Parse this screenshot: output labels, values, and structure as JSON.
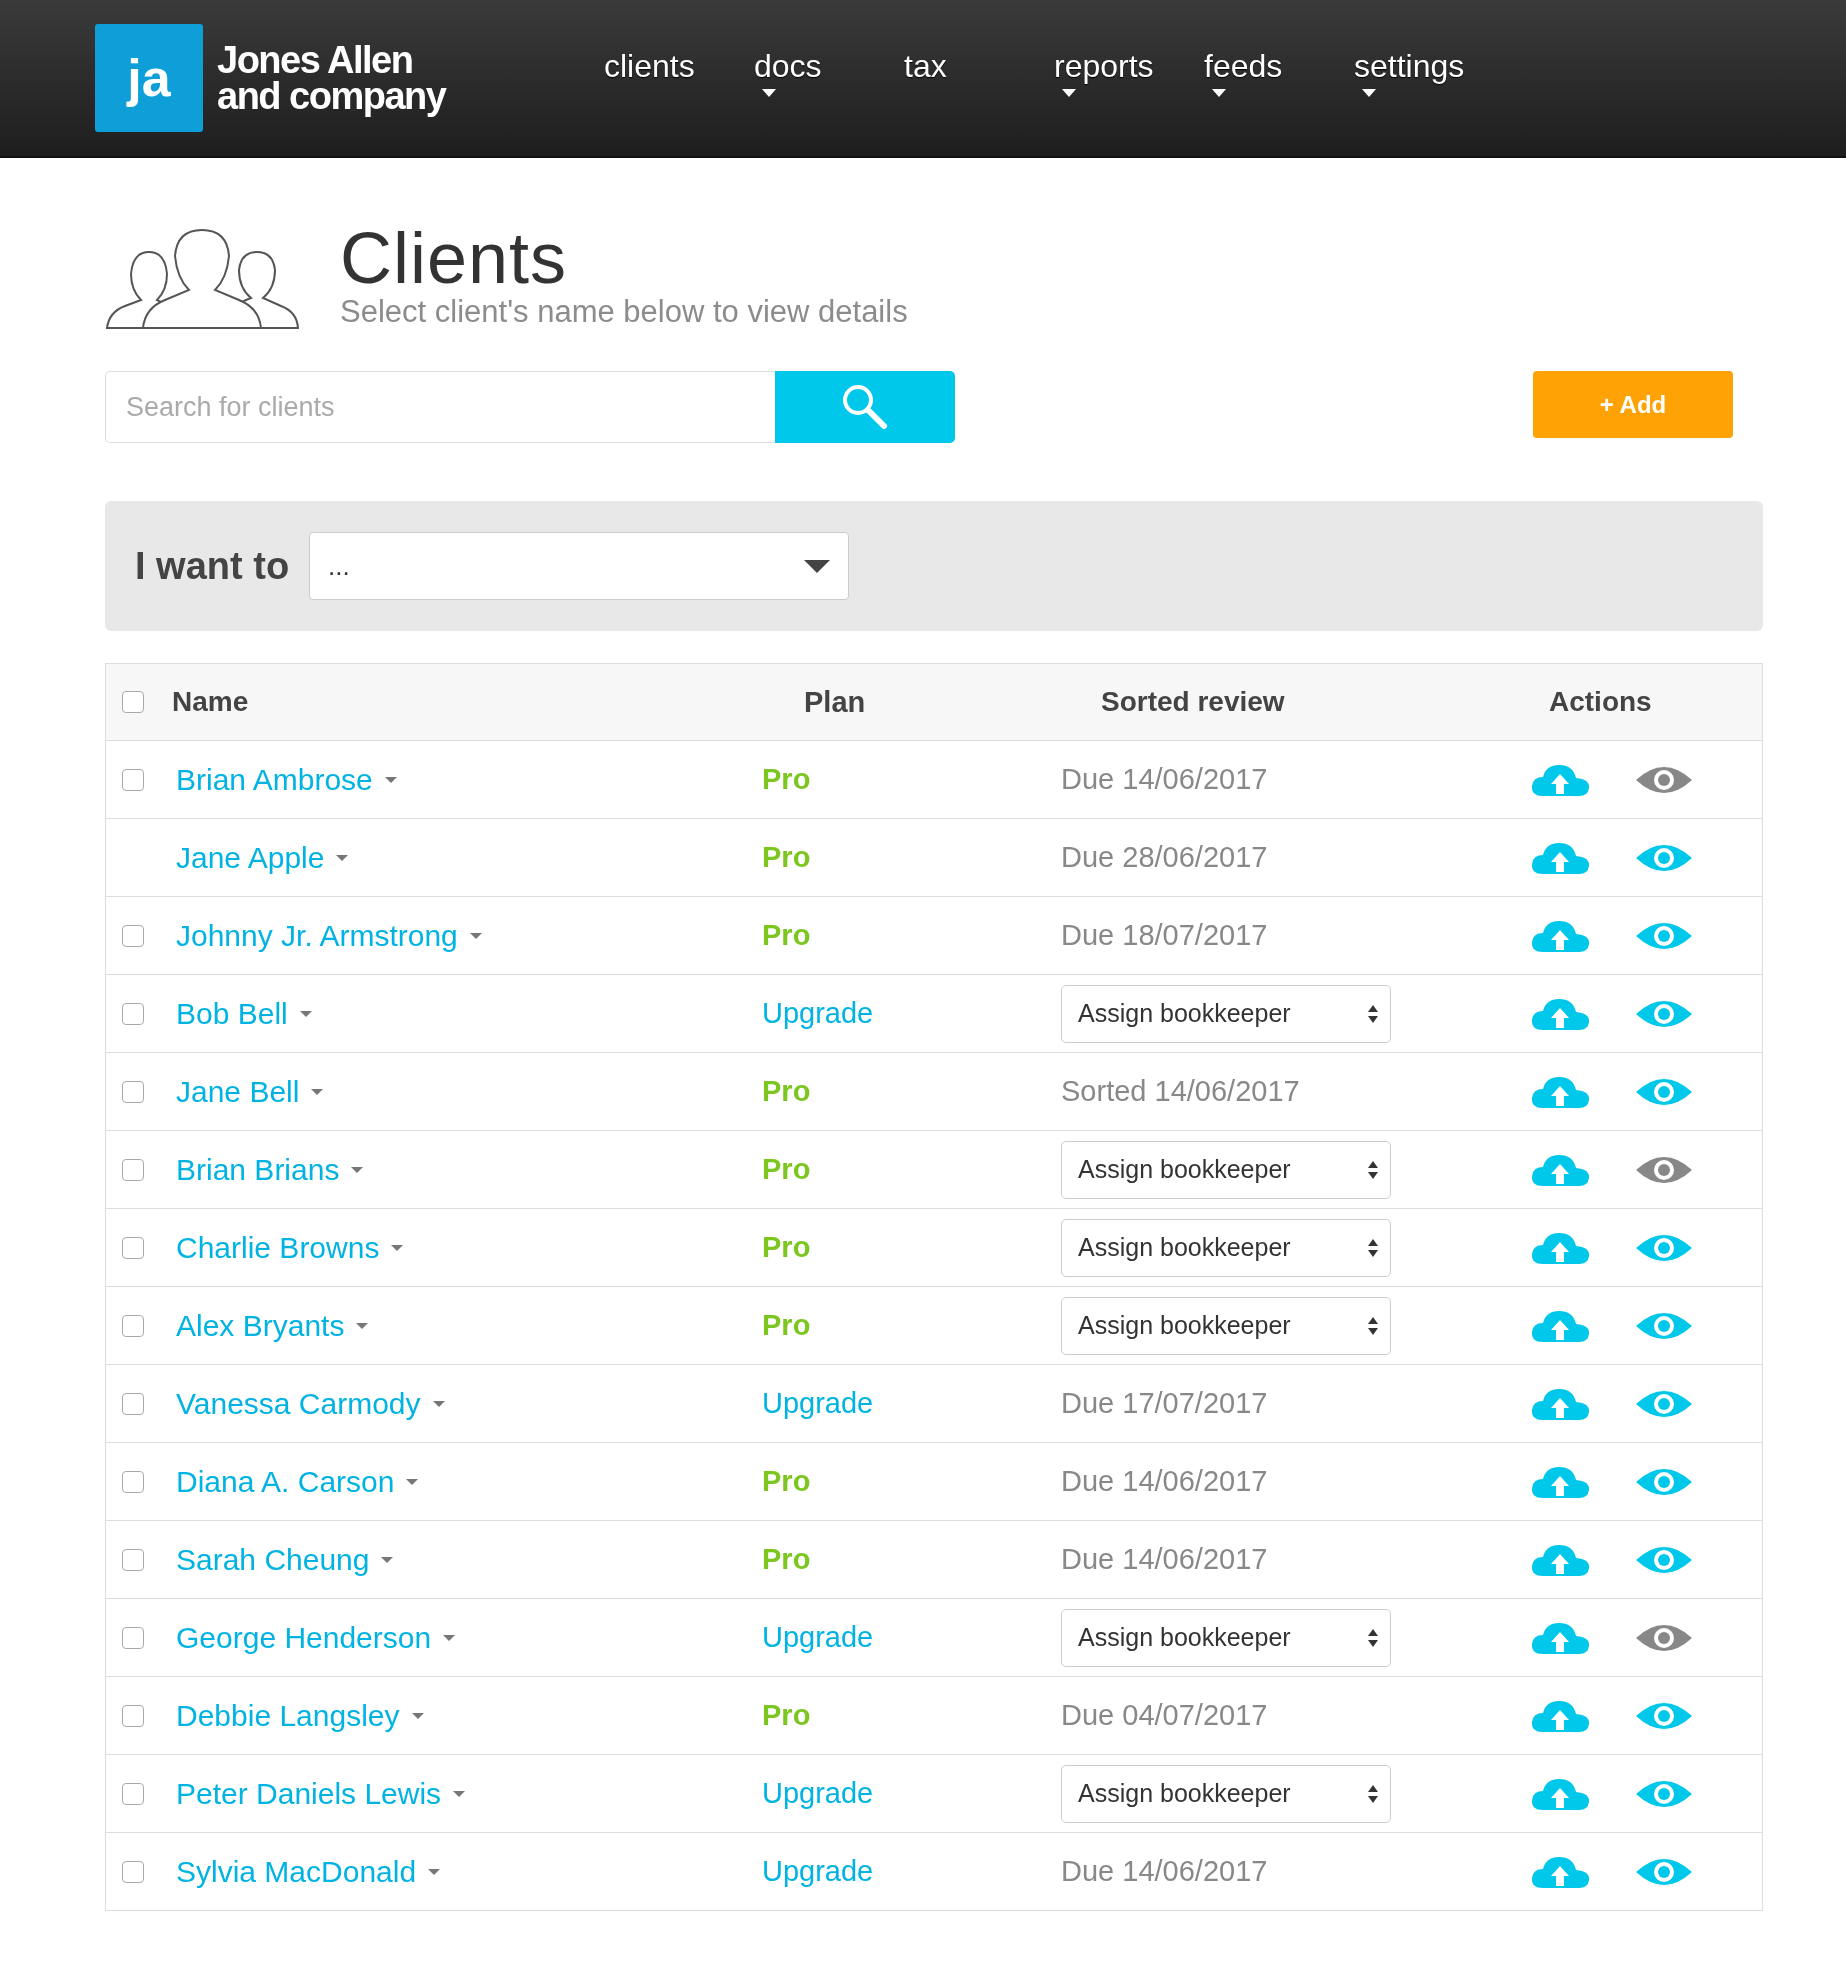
{
  "brand": {
    "logo": "ja",
    "name_line1": "Jones Allen",
    "name_line2": "and company"
  },
  "nav": [
    {
      "label": "clients",
      "has_menu": false
    },
    {
      "label": "docs",
      "has_menu": true
    },
    {
      "label": "tax",
      "has_menu": false
    },
    {
      "label": "reports",
      "has_menu": true
    },
    {
      "label": "feeds",
      "has_menu": true
    },
    {
      "label": "settings",
      "has_menu": true
    }
  ],
  "page": {
    "title": "Clients",
    "subtitle": "Select client's name below to view details"
  },
  "search": {
    "placeholder": "Search for clients"
  },
  "add_button": "+ Add",
  "action_bar": {
    "label": "I want to",
    "value": "..."
  },
  "table": {
    "columns": [
      "Name",
      "Plan",
      "Sorted review",
      "Actions"
    ],
    "header_checked": false,
    "rows": [
      {
        "name": "Brian Ambrose",
        "checked": false,
        "plan": {
          "kind": "pro",
          "label": "Pro"
        },
        "review": {
          "kind": "text",
          "text": "Due 14/06/2017"
        },
        "eye_active": false
      },
      {
        "name": "Jane Apple",
        "plan": {
          "kind": "pro",
          "label": "Pro"
        },
        "review": {
          "kind": "text",
          "text": "Due 28/06/2017"
        },
        "eye_active": true
      },
      {
        "name": "Johnny Jr. Armstrong",
        "checked": false,
        "plan": {
          "kind": "pro",
          "label": "Pro"
        },
        "review": {
          "kind": "text",
          "text": "Due 18/07/2017"
        },
        "eye_active": true
      },
      {
        "name": "Bob Bell",
        "checked": false,
        "plan": {
          "kind": "upgrade",
          "label": "Upgrade"
        },
        "review": {
          "kind": "select",
          "text": "Assign bookkeeper"
        },
        "eye_active": true
      },
      {
        "name": "Jane Bell",
        "checked": false,
        "plan": {
          "kind": "pro",
          "label": "Pro"
        },
        "review": {
          "kind": "text",
          "text": "Sorted 14/06/2017"
        },
        "eye_active": true
      },
      {
        "name": "Brian Brians",
        "checked": false,
        "plan": {
          "kind": "pro",
          "label": "Pro"
        },
        "review": {
          "kind": "select",
          "text": "Assign bookkeeper"
        },
        "eye_active": false
      },
      {
        "name": "Charlie Browns",
        "checked": false,
        "plan": {
          "kind": "pro",
          "label": "Pro"
        },
        "review": {
          "kind": "select",
          "text": "Assign bookkeeper"
        },
        "eye_active": true
      },
      {
        "name": "Alex Bryants",
        "checked": false,
        "plan": {
          "kind": "pro",
          "label": "Pro"
        },
        "review": {
          "kind": "select",
          "text": "Assign bookkeeper"
        },
        "eye_active": true
      },
      {
        "name": "Vanessa Carmody",
        "checked": false,
        "plan": {
          "kind": "upgrade",
          "label": "Upgrade"
        },
        "review": {
          "kind": "text",
          "text": "Due 17/07/2017"
        },
        "eye_active": true
      },
      {
        "name": "Diana A. Carson",
        "checked": false,
        "plan": {
          "kind": "pro",
          "label": "Pro"
        },
        "review": {
          "kind": "text",
          "text": "Due 14/06/2017"
        },
        "eye_active": true
      },
      {
        "name": "Sarah Cheung",
        "checked": false,
        "plan": {
          "kind": "pro",
          "label": "Pro"
        },
        "review": {
          "kind": "text",
          "text": "Due 14/06/2017"
        },
        "eye_active": true
      },
      {
        "name": "George Henderson",
        "checked": false,
        "plan": {
          "kind": "upgrade",
          "label": "Upgrade"
        },
        "review": {
          "kind": "select",
          "text": "Assign bookkeeper"
        },
        "eye_active": false
      },
      {
        "name": "Debbie Langsley",
        "checked": false,
        "plan": {
          "kind": "pro",
          "label": "Pro"
        },
        "review": {
          "kind": "text",
          "text": "Due 04/07/2017"
        },
        "eye_active": true
      },
      {
        "name": "Peter Daniels Lewis",
        "checked": false,
        "plan": {
          "kind": "upgrade",
          "label": "Upgrade"
        },
        "review": {
          "kind": "select",
          "text": "Assign bookkeeper"
        },
        "eye_active": true
      },
      {
        "name": "Sylvia MacDonald",
        "checked": false,
        "plan": {
          "kind": "upgrade",
          "label": "Upgrade"
        },
        "review": {
          "kind": "text",
          "text": "Due 14/06/2017"
        },
        "eye_active": true
      }
    ]
  }
}
